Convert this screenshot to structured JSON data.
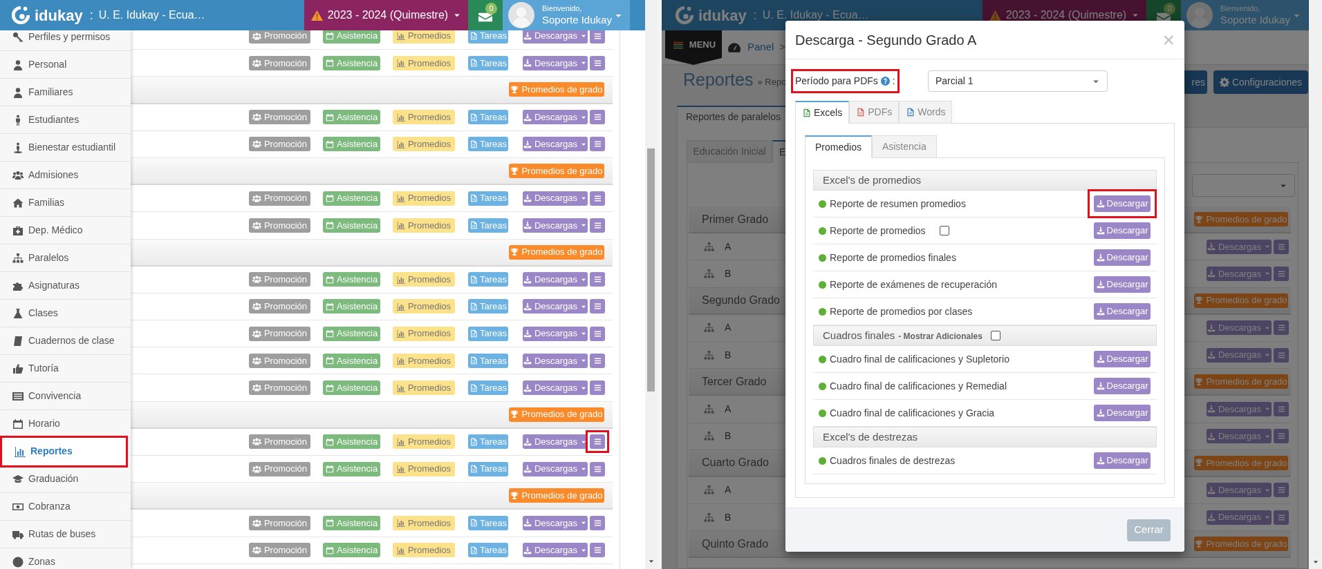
{
  "left_screen": {
    "header": {
      "brand": "idukay",
      "separator": ":",
      "school": "U. E. Idukay - Ecua…",
      "period": "2023 - 2024 (Quimestre)",
      "unread": "0",
      "greeting": "Bienvenido,",
      "user": "Soporte Idukay"
    },
    "sidebar": {
      "items": [
        {
          "label": "Perfiles y permisos",
          "selected": false,
          "highlighted": false
        },
        {
          "label": "Personal",
          "selected": false,
          "highlighted": false
        },
        {
          "label": "Familiares",
          "selected": false,
          "highlighted": false
        },
        {
          "label": "Estudiantes",
          "selected": false,
          "highlighted": false
        },
        {
          "label": "Bienestar estudiantil",
          "selected": false,
          "highlighted": false
        },
        {
          "label": "Admisiones",
          "selected": false,
          "highlighted": false
        },
        {
          "label": "Familias",
          "selected": false,
          "highlighted": false
        },
        {
          "label": "Dep. Médico",
          "selected": false,
          "highlighted": false
        },
        {
          "label": "Paralelos",
          "selected": false,
          "highlighted": false
        },
        {
          "label": "Asignaturas",
          "selected": false,
          "highlighted": false
        },
        {
          "label": "Clases",
          "selected": false,
          "highlighted": false
        },
        {
          "label": "Cuadernos de clase",
          "selected": false,
          "highlighted": false
        },
        {
          "label": "Tutoría",
          "selected": false,
          "highlighted": false
        },
        {
          "label": "Convivencia",
          "selected": false,
          "highlighted": false
        },
        {
          "label": "Horario",
          "selected": false,
          "highlighted": false
        },
        {
          "label": "Reportes",
          "selected": true,
          "highlighted": true
        },
        {
          "label": "Graduación",
          "selected": false,
          "highlighted": false
        },
        {
          "label": "Cobranza",
          "selected": false,
          "highlighted": false
        },
        {
          "label": "Rutas de buses",
          "selected": false,
          "highlighted": false
        },
        {
          "label": "Zonas",
          "selected": false,
          "highlighted": false
        }
      ]
    },
    "rows": [
      {
        "kind": "class",
        "buttons": [
          "Promoción",
          "Asistencia",
          "Promedios",
          "Tareas"
        ],
        "dropdown": "Descargas",
        "menu_highlighted": false
      },
      {
        "kind": "class",
        "buttons": [
          "Promoción",
          "Asistencia",
          "Promedios",
          "Tareas"
        ],
        "dropdown": "Descargas",
        "menu_highlighted": false
      },
      {
        "kind": "grade",
        "button": "Promedios de grado"
      },
      {
        "kind": "class",
        "buttons": [
          "Promoción",
          "Asistencia",
          "Promedios",
          "Tareas"
        ],
        "dropdown": "Descargas",
        "menu_highlighted": false
      },
      {
        "kind": "class",
        "buttons": [
          "Promoción",
          "Asistencia",
          "Promedios",
          "Tareas"
        ],
        "dropdown": "Descargas",
        "menu_highlighted": false
      },
      {
        "kind": "grade",
        "button": "Promedios de grado"
      },
      {
        "kind": "class",
        "buttons": [
          "Promoción",
          "Asistencia",
          "Promedios",
          "Tareas"
        ],
        "dropdown": "Descargas",
        "menu_highlighted": false
      },
      {
        "kind": "class",
        "buttons": [
          "Promoción",
          "Asistencia",
          "Promedios",
          "Tareas"
        ],
        "dropdown": "Descargas",
        "menu_highlighted": false
      },
      {
        "kind": "grade",
        "button": "Promedios de grado"
      },
      {
        "kind": "class",
        "buttons": [
          "Promoción",
          "Asistencia",
          "Promedios",
          "Tareas"
        ],
        "dropdown": "Descargas",
        "menu_highlighted": false
      },
      {
        "kind": "class",
        "buttons": [
          "Promoción",
          "Asistencia",
          "Promedios",
          "Tareas"
        ],
        "dropdown": "Descargas",
        "menu_highlighted": false
      },
      {
        "kind": "class",
        "buttons": [
          "Promoción",
          "Asistencia",
          "Promedios",
          "Tareas"
        ],
        "dropdown": "Descargas",
        "menu_highlighted": false
      },
      {
        "kind": "class",
        "buttons": [
          "Promoción",
          "Asistencia",
          "Promedios",
          "Tareas"
        ],
        "dropdown": "Descargas",
        "menu_highlighted": false
      },
      {
        "kind": "class",
        "buttons": [
          "Promoción",
          "Asistencia",
          "Promedios",
          "Tareas"
        ],
        "dropdown": "Descargas",
        "menu_highlighted": false
      },
      {
        "kind": "grade",
        "button": "Promedios de grado"
      },
      {
        "kind": "class",
        "buttons": [
          "Promoción",
          "Asistencia",
          "Promedios",
          "Tareas"
        ],
        "dropdown": "Descargas",
        "menu_highlighted": true
      },
      {
        "kind": "class",
        "buttons": [
          "Promoción",
          "Asistencia",
          "Promedios",
          "Tareas"
        ],
        "dropdown": "Descargas",
        "menu_highlighted": false
      },
      {
        "kind": "grade",
        "button": "Promedios de grado"
      },
      {
        "kind": "class",
        "buttons": [
          "Promoción",
          "Asistencia",
          "Promedios",
          "Tareas"
        ],
        "dropdown": "Descargas",
        "menu_highlighted": false
      },
      {
        "kind": "class",
        "buttons": [
          "Promoción",
          "Asistencia",
          "Promedios",
          "Tareas"
        ],
        "dropdown": "Descargas",
        "menu_highlighted": false
      }
    ]
  },
  "right_screen": {
    "header": {
      "brand": "idukay",
      "separator": ":",
      "school": "U. E. Idukay - Ecua…",
      "period": "2023 - 2024 (Quimestre)",
      "unread": "0",
      "greeting": "Bienvenido,",
      "user": "Soporte Idukay"
    },
    "menu_label": "MENU",
    "breadcrumb": "Panel",
    "breadcrumb_separator": ">",
    "page_title": "Reportes",
    "page_trail": "» Repo",
    "toolbar_buttons": [
      "res",
      "Configuraciones"
    ],
    "tabs": [
      {
        "label": "Reportes de paralelos",
        "selected": true
      }
    ],
    "level_tabs": [
      {
        "label": "Educación Inicial",
        "selected": false
      },
      {
        "label": "E",
        "selected": true
      }
    ],
    "rows": [
      {
        "kind": "grade",
        "label": "Primer Grado",
        "button": "Promedios de grado"
      },
      {
        "kind": "class",
        "label": "A",
        "dropdown": "Descargas"
      },
      {
        "kind": "class",
        "label": "B",
        "dropdown": "Descargas"
      },
      {
        "kind": "grade",
        "label": "Segundo Grado",
        "button": "Promedios de grado"
      },
      {
        "kind": "class",
        "label": "A",
        "dropdown": "Descargas"
      },
      {
        "kind": "class",
        "label": "B",
        "dropdown": "Descargas"
      },
      {
        "kind": "grade",
        "label": "Tercer Grado",
        "button": "Promedios de grado"
      },
      {
        "kind": "class",
        "label": "A",
        "dropdown": "Descargas"
      },
      {
        "kind": "class",
        "label": "B",
        "dropdown": "Descargas"
      },
      {
        "kind": "grade",
        "label": "Cuarto Grado",
        "button": "Promedios de grado"
      },
      {
        "kind": "class",
        "label": "A",
        "dropdown": "Descargas"
      },
      {
        "kind": "class",
        "label": "B",
        "dropdown": "Descargas"
      },
      {
        "kind": "grade",
        "label": "Quinto Grado",
        "button": "Promedios de grado"
      }
    ],
    "modal": {
      "title": "Descarga - Segundo Grado A",
      "close": "×",
      "period": {
        "label": "Período para PDFs",
        "suffix": ":",
        "highlighted": true,
        "value": "Parcial 1"
      },
      "tabs": [
        {
          "label": "Excels",
          "selected": true
        },
        {
          "label": "PDFs",
          "selected": false
        },
        {
          "label": "Words",
          "selected": false
        }
      ],
      "subtabs": [
        {
          "label": "Promedios",
          "selected": true
        },
        {
          "label": "Asistencia",
          "selected": false
        }
      ],
      "sections": [
        {
          "title": "Excel's de promedios",
          "items": [
            {
              "label": "Reporte de resumen promedios",
              "button": "Descargar",
              "highlighted": true
            },
            {
              "label": "Reporte de promedios",
              "checkbox": {
                "checked": false
              },
              "button": "Descargar",
              "highlighted": false
            },
            {
              "label": "Reporte de promedios finales",
              "button": "Descargar",
              "highlighted": false
            },
            {
              "label": "Reporte de exámenes de recuperación",
              "button": "Descargar",
              "highlighted": false
            },
            {
              "label": "Reporte de promedios por clases",
              "button": "Descargar",
              "highlighted": false
            }
          ]
        },
        {
          "title": "Cuadros finales",
          "subtitle": "- Mostrar Adicionales",
          "checkbox": {
            "checked": false
          },
          "items": [
            {
              "label": "Cuadro final de calificaciones y Supletorio",
              "button": "Descargar",
              "highlighted": false
            },
            {
              "label": "Cuadro final de calificaciones y Remedial",
              "button": "Descargar",
              "highlighted": false
            },
            {
              "label": "Cuadro final de calificaciones y Gracia",
              "button": "Descargar",
              "highlighted": false
            }
          ]
        },
        {
          "title": "Excel's de destrezas",
          "items": [
            {
              "label": "Cuadros finales de destrezas",
              "button": "Descargar",
              "highlighted": false
            }
          ]
        }
      ],
      "footer_button": {
        "label": "Cerrar",
        "disabled": true
      }
    }
  }
}
